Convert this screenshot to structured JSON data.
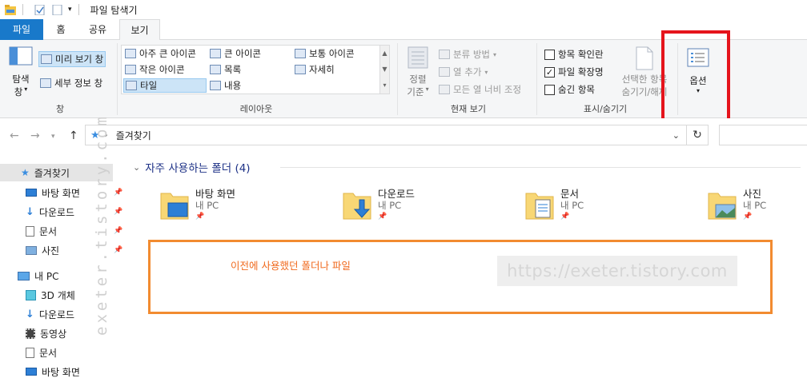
{
  "window": {
    "title": "파일 탐색기"
  },
  "tabs": [
    {
      "label": "파일"
    },
    {
      "label": "홈"
    },
    {
      "label": "공유"
    },
    {
      "label": "보기"
    }
  ],
  "ribbon": {
    "pane": {
      "nav_pane_label": "탐색",
      "nav_pane_label2": "창",
      "preview_label": "미리 보기 창",
      "details_label": "세부 정보 창",
      "group_label": "창"
    },
    "layout": {
      "items": [
        "아주 큰 아이콘",
        "큰 아이콘",
        "보통 아이콘",
        "작은 아이콘",
        "목록",
        "자세히",
        "타일",
        "내용"
      ],
      "group_label": "레이아웃"
    },
    "current_view": {
      "sort_label": "정렬",
      "sort_label2": "기준",
      "group_by": "분류 방법",
      "add_column": "열 추가",
      "fit_columns": "모든 열 너비 조정",
      "group_label": "현재 보기"
    },
    "show_hide": {
      "item_checkboxes": "항목 확인란",
      "file_extensions": "파일 확장명",
      "hidden_items": "숨긴 항목",
      "hide_selected": "선택한 항목",
      "hide_selected2": "숨기기/해제",
      "group_label": "표시/숨기기",
      "item_checkboxes_checked": false,
      "file_extensions_checked": true,
      "hidden_items_checked": false
    },
    "options": {
      "label": "옵션"
    }
  },
  "address": {
    "path": "즐겨찾기"
  },
  "nav": {
    "items": [
      {
        "label": "즐겨찾기"
      },
      {
        "label": "바탕 화면"
      },
      {
        "label": "다운로드"
      },
      {
        "label": "문서"
      },
      {
        "label": "사진"
      },
      {
        "label": "내 PC"
      },
      {
        "label": "3D 개체"
      },
      {
        "label": "다운로드"
      },
      {
        "label": "동영상"
      },
      {
        "label": "문서"
      },
      {
        "label": "바탕 화면"
      }
    ]
  },
  "content": {
    "section_title": "자주 사용하는 폴더 (4)",
    "folders": [
      {
        "name": "바탕 화면",
        "location": "내 PC"
      },
      {
        "name": "다운로드",
        "location": "내 PC"
      },
      {
        "name": "문서",
        "location": "내 PC"
      },
      {
        "name": "사진",
        "location": "내 PC"
      }
    ],
    "annotation": "이전에 사용했던 폴더나 파일"
  },
  "watermark": {
    "url": "https://exeter.tistory.com",
    "vertical": "exeter.tistory.com"
  },
  "colors": {
    "file_tab": "#1979ca",
    "highlight_red": "#e5141c",
    "annotation_orange": "#f28b30",
    "section_blue": "#1e3287"
  }
}
